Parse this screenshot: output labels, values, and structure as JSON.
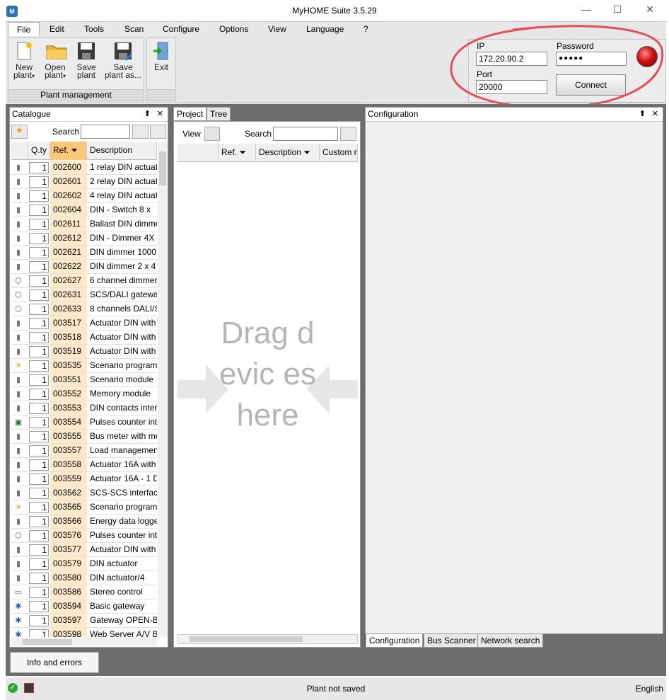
{
  "window": {
    "title": "MyHOME Suite 3.5.29"
  },
  "menu": [
    "File",
    "Edit",
    "Tools",
    "Scan",
    "Configure",
    "Options",
    "View",
    "Language",
    "?"
  ],
  "ribbon": {
    "new_plant": "New plant",
    "open_plant": "Open plant",
    "save_plant": "Save plant",
    "save_plant_as": "Save plant as...",
    "group_label": "Plant management",
    "exit": "Exit"
  },
  "connection": {
    "ip_label": "IP",
    "ip_value": "172.20.90.2",
    "password_label": "Password",
    "password_value": "●●●●●",
    "port_label": "Port",
    "port_value": "20000",
    "connect_label": "Connect",
    "status_color": "#d01010"
  },
  "catalogue": {
    "title": "Catalogue",
    "search_label": "Search",
    "search_value": "",
    "columns": {
      "qty": "Q.ty",
      "ref": "Ref.",
      "description": "Description"
    },
    "rows": [
      {
        "icon": "din-device-icon",
        "qty": "1",
        "ref": "002600",
        "desc": "1 relay DIN actuat"
      },
      {
        "icon": "din-device-icon",
        "qty": "1",
        "ref": "002601",
        "desc": "2 relay DIN actuat"
      },
      {
        "icon": "din-device-icon",
        "qty": "1",
        "ref": "002602",
        "desc": "4 relay DIN actuat"
      },
      {
        "icon": "din-device-icon",
        "qty": "1",
        "ref": "002604",
        "desc": "DIN - Switch  8 x"
      },
      {
        "icon": "din-device-icon",
        "qty": "1",
        "ref": "002611",
        "desc": "Ballast DIN dimme"
      },
      {
        "icon": "din-device-icon",
        "qty": "1",
        "ref": "002612",
        "desc": "DIN - Dimmer 4X"
      },
      {
        "icon": "din-device-icon",
        "qty": "1",
        "ref": "002621",
        "desc": "DIN dimmer 1000"
      },
      {
        "icon": "din-device-icon",
        "qty": "1",
        "ref": "002622",
        "desc": "DIN dimmer 2 x 4"
      },
      {
        "icon": "octagon-icon",
        "qty": "1",
        "ref": "002627",
        "desc": "6 channel dimmer"
      },
      {
        "icon": "octagon-icon",
        "qty": "1",
        "ref": "002631",
        "desc": "SCS/DALI gateway"
      },
      {
        "icon": "octagon-icon",
        "qty": "1",
        "ref": "002633",
        "desc": "8 channels DALI/S"
      },
      {
        "icon": "din-device-icon",
        "qty": "1",
        "ref": "003517",
        "desc": "Actuator DIN with"
      },
      {
        "icon": "din-device-icon",
        "qty": "1",
        "ref": "003518",
        "desc": "Actuator DIN with"
      },
      {
        "icon": "din-device-icon",
        "qty": "1",
        "ref": "003519",
        "desc": "Actuator DIN with"
      },
      {
        "icon": "scenario-icon",
        "qty": "1",
        "ref": "003535",
        "desc": "Scenario programi"
      },
      {
        "icon": "din-device-icon",
        "qty": "1",
        "ref": "003551",
        "desc": "Scenario module"
      },
      {
        "icon": "din-device-icon",
        "qty": "1",
        "ref": "003552",
        "desc": "Memory module"
      },
      {
        "icon": "din-device-icon",
        "qty": "1",
        "ref": "003553",
        "desc": "DIN contacts inter"
      },
      {
        "icon": "counter-icon",
        "qty": "1",
        "ref": "003554",
        "desc": "Pulses counter int"
      },
      {
        "icon": "din-device-icon",
        "qty": "1",
        "ref": "003555",
        "desc": "Bus meter with me"
      },
      {
        "icon": "din-device-icon",
        "qty": "1",
        "ref": "003557",
        "desc": "Load management"
      },
      {
        "icon": "din-device-icon",
        "qty": "1",
        "ref": "003558",
        "desc": "Actuator 16A with"
      },
      {
        "icon": "din-device-icon",
        "qty": "1",
        "ref": "003559",
        "desc": "Actuator 16A - 1 D"
      },
      {
        "icon": "din-device-icon",
        "qty": "1",
        "ref": "003562",
        "desc": "SCS-SCS interface"
      },
      {
        "icon": "scenario-icon",
        "qty": "1",
        "ref": "003565",
        "desc": "Scenario programi"
      },
      {
        "icon": "din-device-icon",
        "qty": "1",
        "ref": "003566",
        "desc": "Energy data logge"
      },
      {
        "icon": "octagon-icon",
        "qty": "1",
        "ref": "003576",
        "desc": "Pulses counter int"
      },
      {
        "icon": "din-device-icon",
        "qty": "1",
        "ref": "003577",
        "desc": "Actuator DIN with"
      },
      {
        "icon": "din-device-icon",
        "qty": "1",
        "ref": "003579",
        "desc": "DIN actuator"
      },
      {
        "icon": "din-device-icon",
        "qty": "1",
        "ref": "003580",
        "desc": "DIN actuator/4"
      },
      {
        "icon": "stereo-icon",
        "qty": "1",
        "ref": "003586",
        "desc": "Stereo control"
      },
      {
        "icon": "gateway-icon",
        "qty": "1",
        "ref": "003594",
        "desc": "Basic gateway"
      },
      {
        "icon": "gateway-icon",
        "qty": "1",
        "ref": "003597",
        "desc": "Gateway OPEN-BA"
      },
      {
        "icon": "gateway-icon",
        "qty": "1",
        "ref": "003598",
        "desc": "Web Server A/V B"
      }
    ]
  },
  "project": {
    "tabs": [
      "Project",
      "Tree"
    ],
    "view_label": "View",
    "search_label": "Search",
    "columns": {
      "ref": "Ref.",
      "description": "Description",
      "custom": "Custom n"
    },
    "placeholder": "Drag devic es here"
  },
  "configuration": {
    "title": "Configuration",
    "tabs": [
      "Configuration",
      "Bus Scanner",
      "Network search"
    ]
  },
  "info_button": "Info and errors",
  "status": {
    "text": "Plant not saved",
    "language": "English"
  }
}
